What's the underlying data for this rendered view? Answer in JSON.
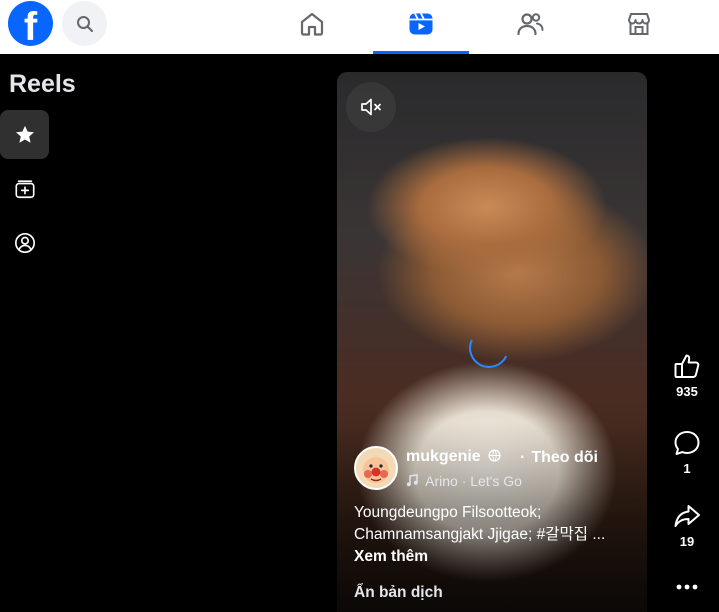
{
  "header": {
    "logo_letter": "f",
    "nav": [
      {
        "name": "home"
      },
      {
        "name": "video",
        "active": true
      },
      {
        "name": "friends"
      },
      {
        "name": "marketplace"
      }
    ]
  },
  "sidebar": {
    "title": "Reels",
    "items": [
      {
        "icon": "star-icon",
        "active": true
      },
      {
        "icon": "create-reel-icon"
      },
      {
        "icon": "profile-icon"
      }
    ]
  },
  "reel": {
    "author": "mukgenie",
    "follow_label": "Theo dõi",
    "separator": "·",
    "music_artist": "Arino",
    "music_sep": "·",
    "music_title": "Let's Go",
    "caption_line1": "Youngdeungpo Filsootteok;",
    "caption_line2": "Chamnamsangjakt Jjigae; #갈막집 ...",
    "see_more": "Xem thêm",
    "hide_translation": "Ẩn bản dịch"
  },
  "actions": {
    "likes": "935",
    "comments": "1",
    "shares": "19"
  },
  "colors": {
    "accent": "#0866ff",
    "background": "#000000",
    "topbar": "#ffffff"
  }
}
